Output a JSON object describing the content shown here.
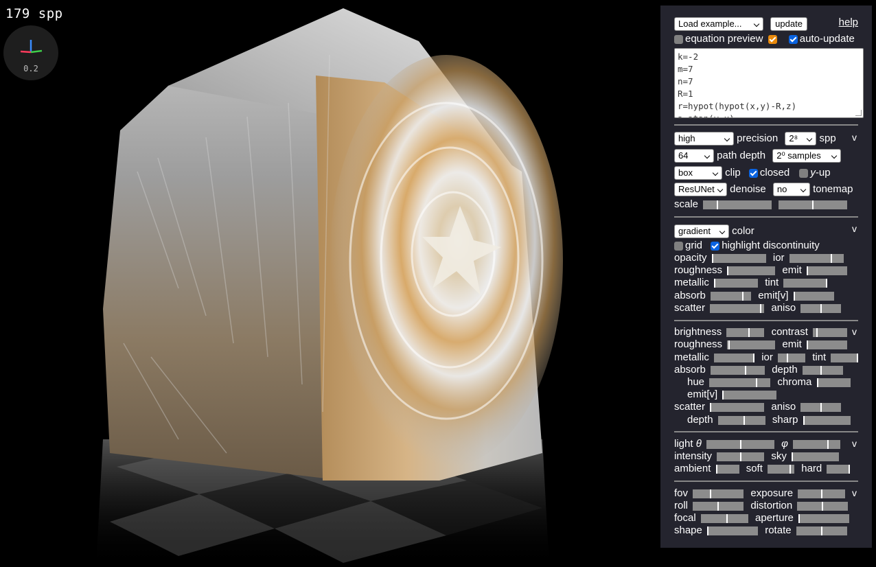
{
  "viewport": {
    "spp_counter": "179 spp",
    "axis_scale": "0.2"
  },
  "toolbar": {
    "example_select": "Load example...",
    "update_label": "update",
    "help_label": "help",
    "equation_preview_label": "equation preview",
    "auto_update_label": "auto-update"
  },
  "code_lines": [
    "k=-2",
    "m=7",
    "n=7",
    "R=1",
    "r=hypot(hypot(x,y)-R,z)",
    "a=atan(y,x)"
  ],
  "render_section": {
    "precision_value": "high",
    "precision_label": "precision",
    "spp_value": "2⁸",
    "spp_label": "spp",
    "path_depth_value": "64",
    "path_depth_label": "path depth",
    "samples_value": "2⁰ samples",
    "clip_value": "box",
    "clip_label": "clip",
    "closed_label": "closed",
    "yup_label": "-up",
    "yup_var": "y",
    "denoise_value": "ResUNet",
    "denoise_label": "denoise",
    "tonemap_value": "no",
    "tonemap_label": "tonemap",
    "scale_label": "scale",
    "collapse": "v"
  },
  "material_section": {
    "color_value": "gradient",
    "color_label": "color",
    "grid_label": "grid",
    "highlight_label": "highlight discontinuity",
    "collapse": "v",
    "labels": {
      "opacity": "opacity",
      "ior": "ior",
      "roughness": "roughness",
      "emit": "emit",
      "metallic": "metallic",
      "tint": "tint",
      "absorb": "absorb",
      "emitv": "emit[v]",
      "scatter": "scatter",
      "aniso": "aniso"
    }
  },
  "floor_section": {
    "collapse": "v",
    "labels": {
      "brightness": "brightness",
      "contrast": "contrast",
      "roughness": "roughness",
      "emit": "emit",
      "metallic": "metallic",
      "ior": "ior",
      "tint": "tint",
      "absorb": "absorb",
      "depth": "depth",
      "hue": "hue",
      "chroma": "chroma",
      "emitv": "emit[v]",
      "scatter": "scatter",
      "aniso": "aniso",
      "depth2": "depth",
      "sharp": "sharp"
    }
  },
  "light_section": {
    "collapse": "v",
    "light_label": "light ",
    "theta": "θ",
    "phi": "φ",
    "intensity_label": "intensity",
    "sky_label": "sky",
    "ambient_label": "ambient",
    "soft_label": "soft",
    "hard_label": "hard"
  },
  "camera_section": {
    "collapse": "v",
    "labels": {
      "fov": "fov",
      "exposure": "exposure",
      "roll": "roll",
      "distortion": "distortion",
      "focal": "focal",
      "aperture": "aperture",
      "shape": "shape",
      "rotate": "rotate"
    }
  },
  "slider_levels": {
    "scale_a": 0.2,
    "scale_b": 0.5,
    "opacity": 0.0,
    "ior": 0.78,
    "roughness": 0.0,
    "emit": 0.0,
    "metallic": 0.0,
    "tint": 1.0,
    "absorb": 0.8,
    "emitv": 0.0,
    "scatter": 0.95,
    "aniso": 0.5,
    "f_brightness": 0.6,
    "f_contrast": 0.1,
    "f_roughness": 0.03,
    "f_emit": 0.0,
    "f_metallic": 1.0,
    "f_ior": 0.35,
    "f_tint": 1.0,
    "f_absorb": 0.65,
    "f_depth": 0.45,
    "f_hue": 0.78,
    "f_chroma": 0.0,
    "f_emitv": 0.0,
    "f_scatter": 0.0,
    "f_aniso": 0.5,
    "f_depth2": 0.55,
    "f_sharp": 0.0,
    "light_theta": 0.5,
    "light_phi": 0.75,
    "intensity": 0.5,
    "sky": 0.0,
    "ambient": 0.0,
    "soft": 0.85,
    "hard": 1.0,
    "fov": 0.35,
    "exposure": 0.5,
    "roll": 0.5,
    "distortion": 0.5,
    "focal": 0.55,
    "aperture": 0.0,
    "shape": 0.0,
    "rotate": 0.5
  }
}
